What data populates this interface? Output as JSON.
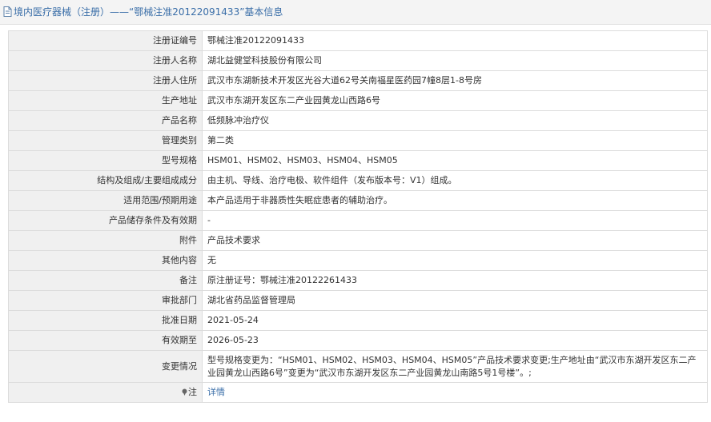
{
  "header": {
    "title": "境内医疗器械（注册）——“鄂械注准20122091433”基本信息"
  },
  "rows": [
    {
      "label": "注册证编号",
      "value": "鄂械注准20122091433"
    },
    {
      "label": "注册人名称",
      "value": "湖北益健堂科技股份有限公司"
    },
    {
      "label": "注册人住所",
      "value": "武汉市东湖新技术开发区光谷大道62号关南福星医药园7幢8层1-8号房"
    },
    {
      "label": "生产地址",
      "value": "武汉市东湖开发区东二产业园黄龙山西路6号"
    },
    {
      "label": "产品名称",
      "value": "低频脉冲治疗仪"
    },
    {
      "label": "管理类别",
      "value": "第二类"
    },
    {
      "label": "型号规格",
      "value": "HSM01、HSM02、HSM03、HSM04、HSM05"
    },
    {
      "label": "结构及组成/主要组成成分",
      "value": "由主机、导线、治疗电极、软件组件（发布版本号：V1）组成。"
    },
    {
      "label": "适用范围/预期用途",
      "value": "本产品适用于非器质性失眠症患者的辅助治疗。"
    },
    {
      "label": "产品储存条件及有效期",
      "value": "-"
    },
    {
      "label": "附件",
      "value": "产品技术要求"
    },
    {
      "label": "其他内容",
      "value": "无"
    },
    {
      "label": "备注",
      "value": "原注册证号：鄂械注准20122261433"
    },
    {
      "label": "审批部门",
      "value": "湖北省药品监督管理局"
    },
    {
      "label": "批准日期",
      "value": "2021-05-24"
    },
    {
      "label": "有效期至",
      "value": "2026-05-23"
    },
    {
      "label": "变更情况",
      "value": "型号规格变更为：“HSM01、HSM02、HSM03、HSM04、HSM05”产品技术要求变更;生产地址由“武汉市东湖开发区东二产业园黄龙山西路6号”变更为“武汉市东湖开发区东二产业园黄龙山南路5号1号楼”。;"
    }
  ],
  "note_row": {
    "label": "注",
    "link_text": "详情"
  },
  "colors": {
    "link": "#3a6ea8",
    "label_bg": "#f0f0f0",
    "border": "#dcdcdc"
  },
  "icons": {
    "title": "document-icon",
    "note": "pin-icon"
  }
}
